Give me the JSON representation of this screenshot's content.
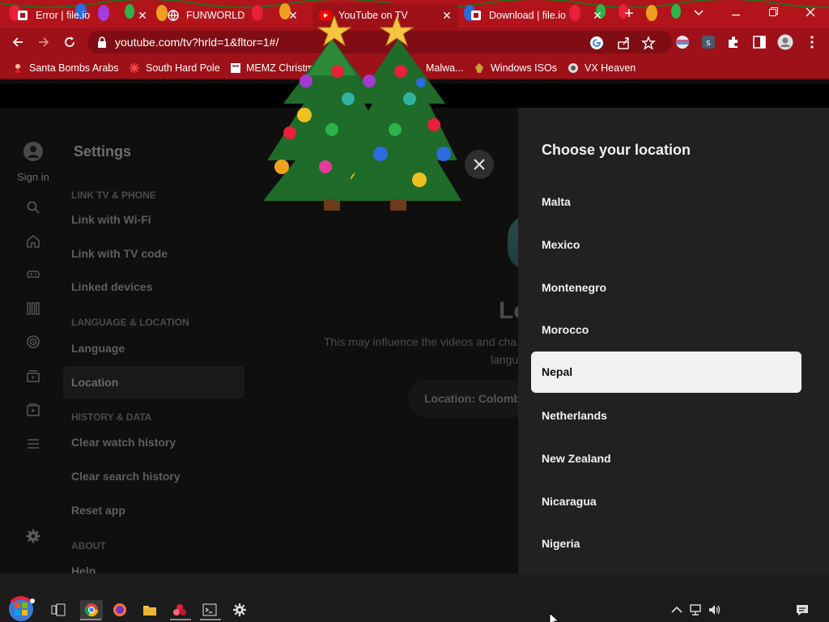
{
  "browser": {
    "tabs": [
      {
        "title": "Error | file.io",
        "favicon": "file-io-favicon"
      },
      {
        "title": "FUNWORLD",
        "favicon": "globe-icon"
      },
      {
        "title": "YouTube on TV",
        "favicon": "youtube-icon"
      },
      {
        "title": "Download | file.io",
        "favicon": "file-io-favicon"
      }
    ],
    "url": "youtube.com/tv?hrld=1&fltor=1#/",
    "bookmarks": [
      {
        "label": "Santa Bombs Arabs",
        "icon": "santa-icon"
      },
      {
        "label": "South Hard Pole",
        "icon": "snowflake-icon"
      },
      {
        "label": "MEMZ Christm...",
        "icon": "page-icon"
      },
      {
        "label": "Malwa...",
        "icon": "page-icon"
      },
      {
        "label": "Windows ISOs",
        "icon": "windows-iso-icon"
      },
      {
        "label": "VX Heaven",
        "icon": "vx-heaven-icon"
      }
    ],
    "theme_color": "#b3141b"
  },
  "youtube": {
    "sidebar": {
      "sign_in": "Sign in"
    },
    "settings": {
      "title": "Settings",
      "sections": [
        {
          "heading": "LINK TV & PHONE",
          "items": [
            "Link with Wi-Fi",
            "Link with TV code",
            "Linked devices"
          ]
        },
        {
          "heading": "LANGUAGE & LOCATION",
          "items": [
            "Language",
            "Location"
          ]
        },
        {
          "heading": "HISTORY & DATA",
          "items": [
            "Clear watch history",
            "Clear search history",
            "Reset app"
          ]
        },
        {
          "heading": "ABOUT",
          "items": [
            "Help"
          ]
        }
      ],
      "selected_item": "Location"
    },
    "location_page": {
      "title": "Lo",
      "description": "This may influence the videos and cha",
      "description_line2": "langu",
      "current": "Location: Colombi"
    },
    "location_panel": {
      "title": "Choose your location",
      "options": [
        "Malta",
        "Mexico",
        "Montenegro",
        "Morocco",
        "Nepal",
        "Netherlands",
        "New Zealand",
        "Nicaragua",
        "Nigeria"
      ],
      "selected": "Nepal"
    }
  },
  "taskbar": {
    "apps": [
      "task-view-icon",
      "chrome-icon",
      "firefox-icon",
      "file-explorer-icon",
      "app-icon",
      "terminal-icon",
      "settings-icon"
    ],
    "tray": [
      "chevron-up-icon",
      "network-icon",
      "volume-icon",
      "notification-icon"
    ]
  }
}
